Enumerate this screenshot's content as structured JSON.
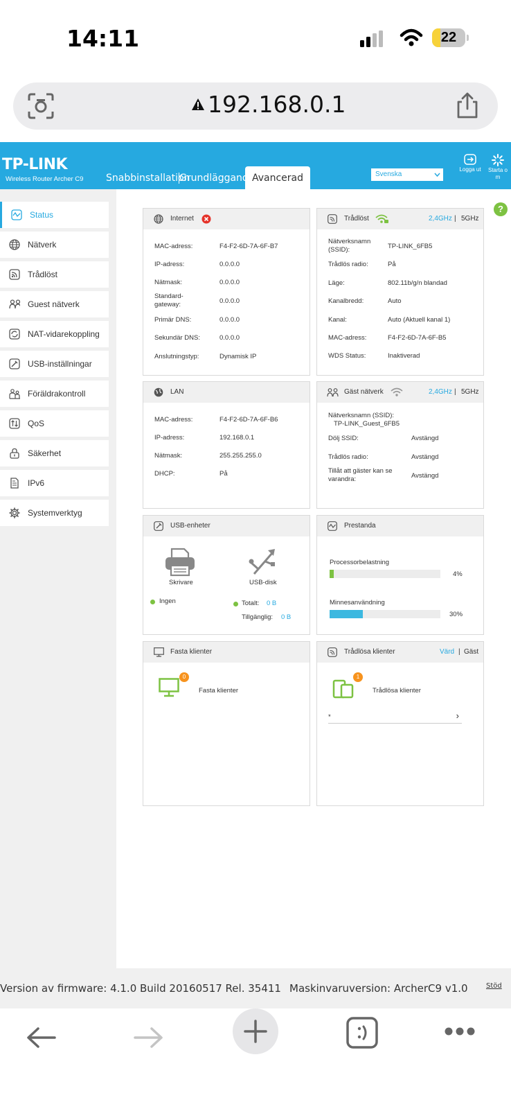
{
  "status_bar": {
    "time": "14:11",
    "battery": "22"
  },
  "browser": {
    "url": "192.168.0.1"
  },
  "router": {
    "logo": "TP-LINK",
    "model": "Wireless Router Archer C9",
    "tabs": [
      "Snabbinstallation",
      "Grundläggande",
      "Avancerad"
    ],
    "active_tab": "Avancerad",
    "language": "Svenska",
    "logout": "Logga ut",
    "reboot": "Starta o\nm",
    "help_icon": "question-icon"
  },
  "sidebar": {
    "items": [
      {
        "label": "Status",
        "icon": "status-icon",
        "active": true
      },
      {
        "label": "Nätverk",
        "icon": "globe-icon"
      },
      {
        "label": "Trådlöst",
        "icon": "wireless-icon"
      },
      {
        "label": "Guest nätverk",
        "icon": "guest-icon"
      },
      {
        "label": "NAT-vidarekoppling",
        "icon": "nat-icon"
      },
      {
        "label": "USB-inställningar",
        "icon": "usb-settings-icon"
      },
      {
        "label": "Föräldrakontroll",
        "icon": "parental-icon"
      },
      {
        "label": "QoS",
        "icon": "qos-icon"
      },
      {
        "label": "Säkerhet",
        "icon": "lock-icon"
      },
      {
        "label": "IPv6",
        "icon": "ipv6-icon"
      },
      {
        "label": "Systemverktyg",
        "icon": "gear-icon"
      }
    ]
  },
  "internet": {
    "title": "Internet",
    "rows": [
      {
        "label": "MAC-adress:",
        "value": "F4-F2-6D-7A-6F-B7"
      },
      {
        "label": "IP-adress:",
        "value": "0.0.0.0"
      },
      {
        "label": "Nätmask:",
        "value": "0.0.0.0"
      },
      {
        "label": "Standard-\ngateway:",
        "value": "0.0.0.0"
      },
      {
        "label": "Primär DNS:",
        "value": "0.0.0.0"
      },
      {
        "label": "Sekundär DNS:",
        "value": "0.0.0.0"
      },
      {
        "label": "Anslutningstyp:",
        "value": "Dynamisk IP"
      }
    ]
  },
  "wireless": {
    "title": "Trådlöst",
    "band_a": "2,4GHz",
    "separator": "|",
    "band_b": "5GHz",
    "rows": [
      {
        "label": "Nätverksnamn\n(SSID):",
        "value": "TP-LINK_6FB5"
      },
      {
        "label": "Trådlös radio:",
        "value": "På"
      },
      {
        "label": "Läge:",
        "value": "802.11b/g/n blandad"
      },
      {
        "label": "Kanalbredd:",
        "value": "Auto"
      },
      {
        "label": "Kanal:",
        "value": "Auto (Aktuell kanal 1)"
      },
      {
        "label": "MAC-adress:",
        "value": "F4-F2-6D-7A-6F-B5"
      },
      {
        "label": "WDS Status:",
        "value": "Inaktiverad"
      }
    ]
  },
  "lan": {
    "title": "LAN",
    "rows": [
      {
        "label": "MAC-adress:",
        "value": "F4-F2-6D-7A-6F-B6"
      },
      {
        "label": "IP-adress:",
        "value": "192.168.0.1"
      },
      {
        "label": "Nätmask:",
        "value": "255.255.255.0"
      },
      {
        "label": "DHCP:",
        "value": "På"
      }
    ]
  },
  "guest": {
    "title": "Gäst nätverk",
    "band_a": "2,4GHz",
    "separator": "|",
    "band_b": "5GHz",
    "ssid_label": "Nätverksnamn (SSID):",
    "ssid_value": "TP-LINK_Guest_6FB5",
    "rows": [
      {
        "label": "Dölj SSID:",
        "value": "Avstängd"
      },
      {
        "label": "Trådlös radio:",
        "value": "Avstängd"
      },
      {
        "label": "Tillåt att gäster kan se\nvarandra:",
        "value": "Avstängd"
      }
    ]
  },
  "usb": {
    "title": "USB-enheter",
    "printer_label": "Skrivare",
    "disk_label": "USB-disk",
    "printer_status": "Ingen",
    "total_label": "Totalt:",
    "total_value": "0 B",
    "avail_label": "Tillgänglig:",
    "avail_value": "0 B"
  },
  "performance": {
    "title": "Prestanda",
    "cpu_label": "Processorbelastning",
    "cpu_value": "4%",
    "cpu_fraction": 0.04,
    "mem_label": "Minnesanvändning",
    "mem_value": "30%",
    "mem_fraction": 0.3
  },
  "wired_clients": {
    "title": "Fasta klienter",
    "count": "0",
    "label": "Fasta klienter"
  },
  "wireless_clients": {
    "title": "Trådlösa klienter",
    "host": "Värd",
    "separator": "|",
    "guest": "Gäst",
    "count": "1",
    "label": "Trådlösa klienter",
    "row_name": "*",
    "row_arrow": "›"
  },
  "footer": {
    "firmware": "Version av firmware: 4.1.0 Build 20160517 Rel. 35411",
    "hardware": "Maskinvaruversion: ArcherC9 v1.0",
    "support": "Stöd"
  },
  "colors": {
    "brand": "#26a9e0",
    "green": "#7dc242",
    "orange": "#f7931e",
    "red": "#e5332a"
  }
}
